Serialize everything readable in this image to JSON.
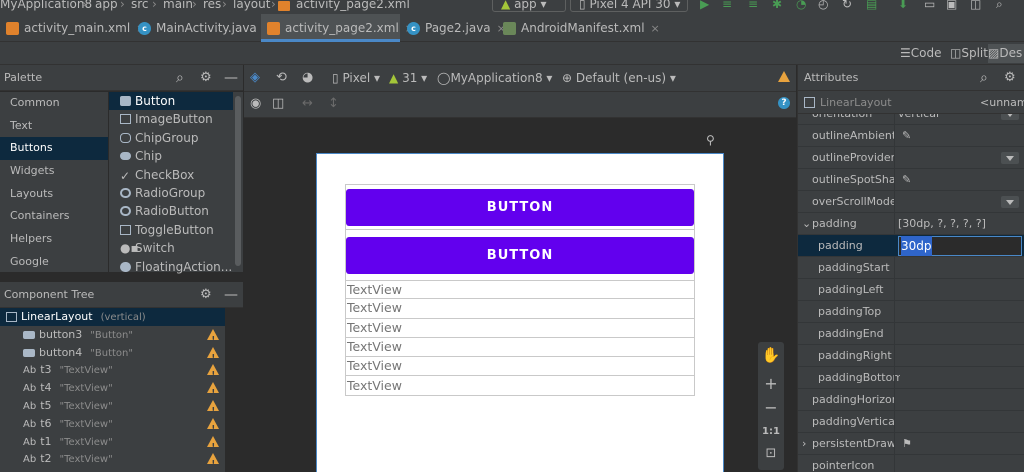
{
  "topbar": {
    "project": "MyApplication8",
    "crumbs": [
      "app",
      "src",
      "main",
      "res",
      "layout",
      "activity_page2.xml"
    ],
    "module": "app",
    "device": "Pixel 4 API 30"
  },
  "tabs": [
    {
      "label": "activity_main.xml",
      "icon": "xml-file-icon",
      "color": "#e0822c"
    },
    {
      "label": "MainActivity.java",
      "icon": "class-file-icon",
      "color": "#3592c4"
    },
    {
      "label": "activity_page2.xml",
      "icon": "xml-file-icon",
      "color": "#e0822c",
      "active": true
    },
    {
      "label": "Page2.java",
      "icon": "class-file-icon",
      "color": "#3592c4"
    },
    {
      "label": "AndroidManifest.xml",
      "icon": "manifest-file-icon",
      "color": "#6a8759"
    }
  ],
  "view_modes": {
    "code": "Code",
    "split": "Split",
    "design": "Des"
  },
  "palette": {
    "title": "Palette",
    "categories": [
      "Common",
      "Text",
      "Buttons",
      "Widgets",
      "Layouts",
      "Containers",
      "Helpers",
      "Google"
    ],
    "selected_category": "Buttons",
    "items": [
      "Button",
      "ImageButton",
      "ChipGroup",
      "Chip",
      "CheckBox",
      "RadioGroup",
      "RadioButton",
      "ToggleButton",
      "Switch",
      "FloatingAction..."
    ]
  },
  "component_tree": {
    "title": "Component Tree",
    "root": {
      "label": "LinearLayout",
      "sub": "(vertical)"
    },
    "children": [
      {
        "id": "button3",
        "text": "\"Button\"",
        "type": "button"
      },
      {
        "id": "button4",
        "text": "\"Button\"",
        "type": "button"
      },
      {
        "id": "t3",
        "text": "\"TextView\"",
        "type": "text"
      },
      {
        "id": "t4",
        "text": "\"TextView\"",
        "type": "text"
      },
      {
        "id": "t5",
        "text": "\"TextView\"",
        "type": "text"
      },
      {
        "id": "t6",
        "text": "\"TextView\"",
        "type": "text"
      },
      {
        "id": "t1",
        "text": "\"TextView\"",
        "type": "text"
      },
      {
        "id": "t2",
        "text": "\"TextView\"",
        "type": "text"
      }
    ]
  },
  "design_toolbar": {
    "device": "Pixel",
    "api": "31",
    "theme": "MyApplication8",
    "locale": "Default (en-us)"
  },
  "preview": {
    "buttons": [
      "BUTTON",
      "BUTTON"
    ],
    "textviews": [
      "TextView",
      "TextView",
      "TextView",
      "TextView",
      "TextView",
      "TextView"
    ]
  },
  "zoom": {
    "plus": "+",
    "minus": "−",
    "ratio": "1:1"
  },
  "attributes": {
    "title": "Attributes",
    "header_class": "LinearLayout",
    "header_id": "<unnam",
    "rows": [
      {
        "name": "orientation",
        "value": "vertical",
        "dropdown": true
      },
      {
        "name": "outlineAmbient...",
        "value": "",
        "picker": true
      },
      {
        "name": "outlineProvider",
        "value": "",
        "dropdown": true
      },
      {
        "name": "outlineSpotSha...",
        "value": "",
        "picker": true
      },
      {
        "name": "overScrollMode",
        "value": "",
        "dropdown": true
      },
      {
        "name": "padding",
        "value": "[30dp, ?, ?, ?, ?]",
        "expanded": true
      },
      {
        "name": "padding",
        "value": "30dp",
        "selected": true
      },
      {
        "name": "paddingStart",
        "value": ""
      },
      {
        "name": "paddingLeft",
        "value": ""
      },
      {
        "name": "paddingTop",
        "value": ""
      },
      {
        "name": "paddingEnd",
        "value": ""
      },
      {
        "name": "paddingRight",
        "value": ""
      },
      {
        "name": "paddingBottom",
        "value": ""
      },
      {
        "name": "paddingHorizon...",
        "value": ""
      },
      {
        "name": "paddingVertical",
        "value": ""
      },
      {
        "name": "persistentDrawi...",
        "value": "",
        "flag": true,
        "collapsed": true
      },
      {
        "name": "pointerIcon",
        "value": ""
      }
    ]
  },
  "colors": {
    "accent": "#4a88c7",
    "button": "#6200ee",
    "warning": "#e8a33e",
    "run": "#499c54"
  }
}
